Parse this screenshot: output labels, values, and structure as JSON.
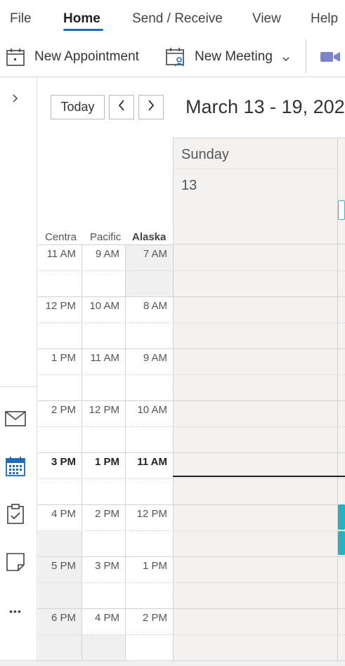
{
  "ribbon": {
    "tabs": [
      {
        "label": "File"
      },
      {
        "label": "Home"
      },
      {
        "label": "Send / Receive"
      },
      {
        "label": "View"
      },
      {
        "label": "Help"
      }
    ],
    "active_tab": "Home",
    "commands": {
      "new_appointment": "New Appointment",
      "new_meeting": "New Meeting"
    }
  },
  "navigation": {
    "today_label": "Today",
    "prev_glyph": "‹",
    "next_glyph": "›",
    "date_range": "March 13 - 19, 202"
  },
  "rail": {
    "expand_glyph": "›",
    "more_glyph": "•••"
  },
  "timezones": {
    "headers": [
      "Centra",
      "Pacific",
      "Alaska"
    ],
    "rows": [
      {
        "central": "11 AM",
        "pacific": "9 AM",
        "alaska": "7 AM"
      },
      {
        "central": "12 PM",
        "pacific": "10 AM",
        "alaska": "8 AM"
      },
      {
        "central": "1 PM",
        "pacific": "11 AM",
        "alaska": "9 AM"
      },
      {
        "central": "2 PM",
        "pacific": "12 PM",
        "alaska": "10 AM"
      },
      {
        "central": "3 PM",
        "pacific": "1 PM",
        "alaska": "11 AM"
      },
      {
        "central": "4 PM",
        "pacific": "2 PM",
        "alaska": "12 PM"
      },
      {
        "central": "5 PM",
        "pacific": "3 PM",
        "alaska": "1 PM"
      },
      {
        "central": "6 PM",
        "pacific": "4 PM",
        "alaska": "2 PM"
      }
    ],
    "current_row_index": 4
  },
  "day": {
    "name": "Sunday",
    "number": "13"
  },
  "colors": {
    "accent": "#1e6ab8",
    "event": "#1fb5c0",
    "now_line": "#222222",
    "grid_bg": "#f3f2f1"
  }
}
